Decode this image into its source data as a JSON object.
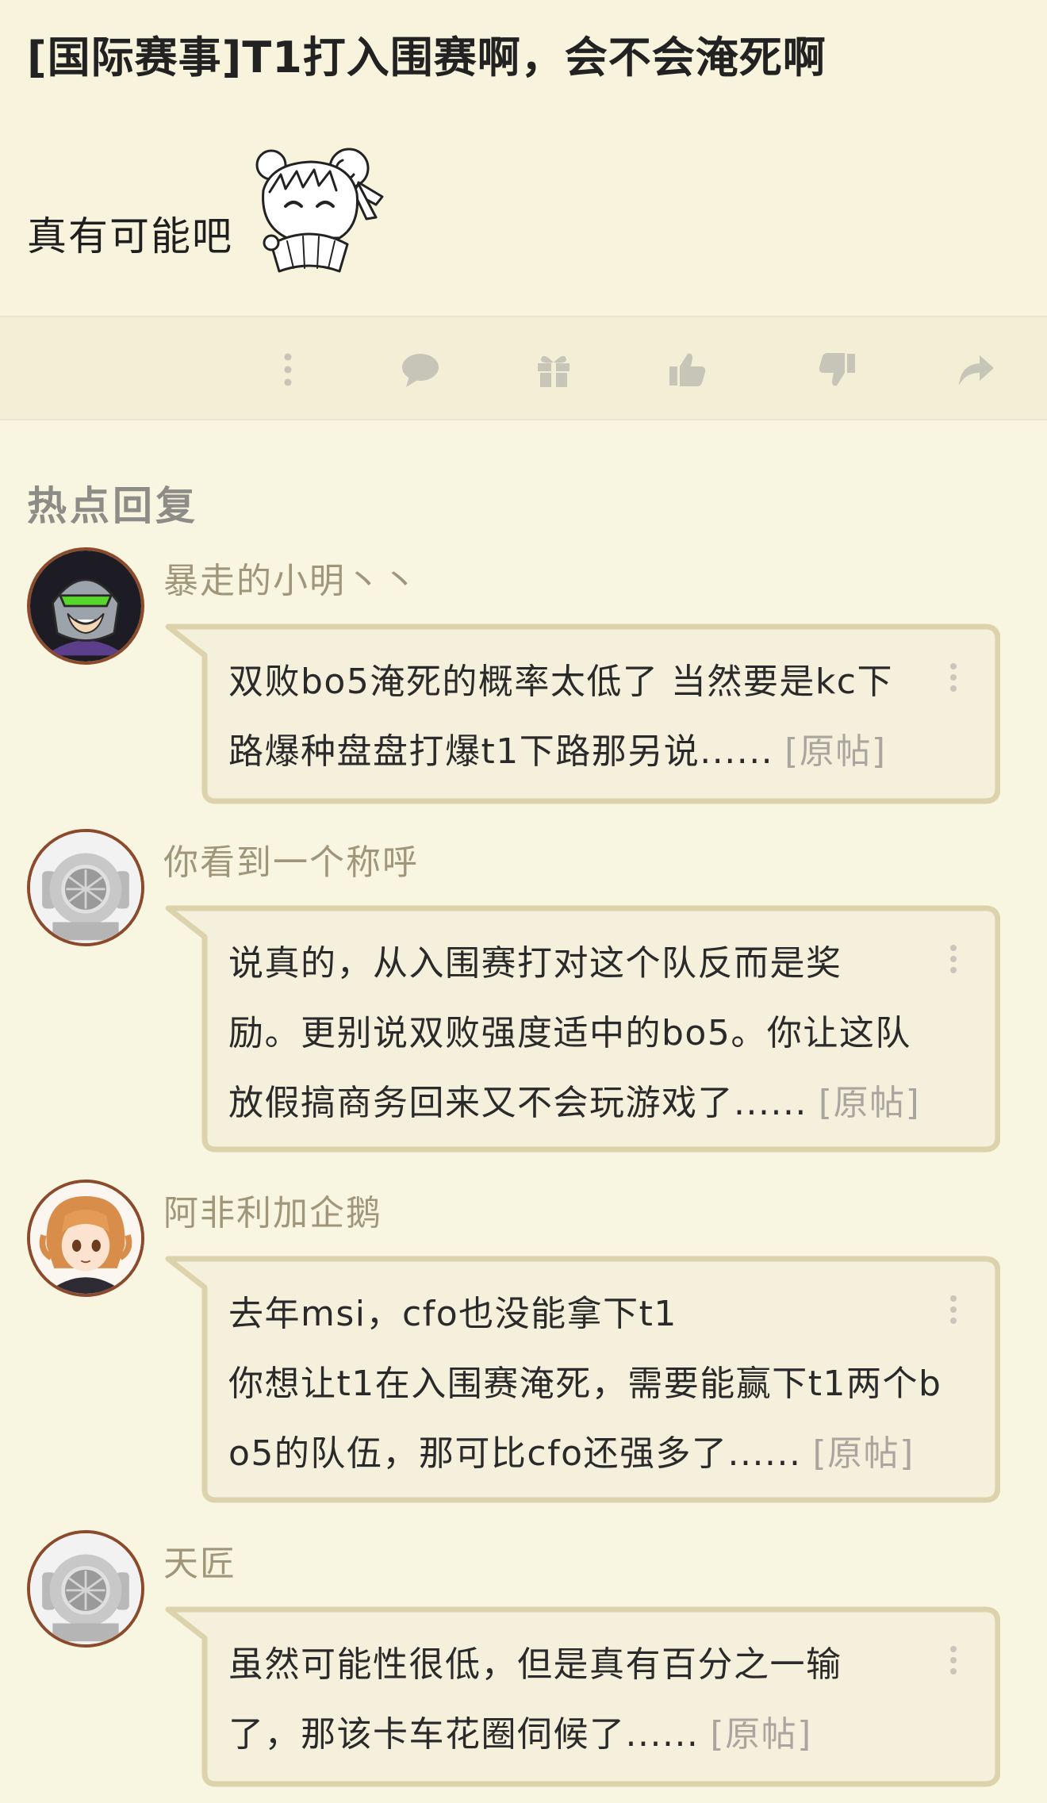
{
  "post": {
    "title": "[国际赛事]T1打入围赛啊，会不会淹死啊",
    "body": "真有可能吧"
  },
  "actions": [
    {
      "name": "more-icon"
    },
    {
      "name": "comment-icon"
    },
    {
      "name": "gift-icon"
    },
    {
      "name": "thumbs-up-icon"
    },
    {
      "name": "thumbs-down-icon"
    },
    {
      "name": "share-icon"
    }
  ],
  "hot_replies": {
    "title": "热点回复",
    "source_label": "[原帖]",
    "items": [
      {
        "username": "暴走的小明丶丶",
        "avatar": "robot-helmet-avatar",
        "lines": [
          "双败bo5淹死的概率太低了 当然要是kc下",
          "路爆种盘盘打爆t1下路那另说......"
        ]
      },
      {
        "username": "你看到一个称呼",
        "avatar": "diving-helmet-avatar",
        "lines": [
          "说真的，从入围赛打对这个队反而是奖",
          "励。更别说双败强度适中的bo5。你让这队",
          "放假搞商务回来又不会玩游戏了......"
        ]
      },
      {
        "username": "阿非利加企鹅",
        "avatar": "anime-girl-avatar",
        "lines": [
          "去年msi，cfo也没能拿下t1",
          "你想让t1在入围赛淹死，需要能赢下t1两个b",
          "o5的队伍，那可比cfo还强多了......"
        ]
      },
      {
        "username": "天匠",
        "avatar": "diving-helmet-avatar",
        "lines": [
          "虽然可能性很低，但是真有百分之一输",
          "了，那该卡车花圈伺候了......"
        ]
      }
    ]
  },
  "colors": {
    "background": "#f8f5e1",
    "bubble_border": "#dcd3ad",
    "username": "#a0967a",
    "icon": "#c7c4b8",
    "avatar_ring": "#8b4a2b"
  }
}
